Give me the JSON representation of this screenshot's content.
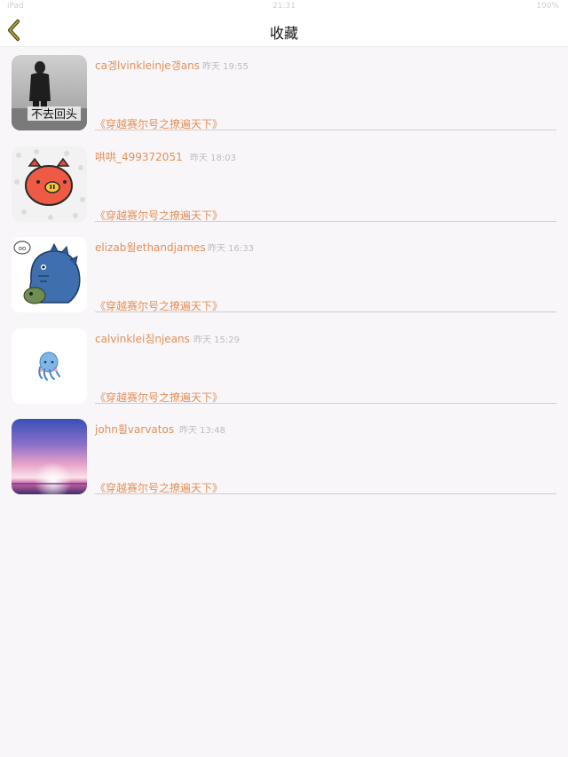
{
  "status_bar": {
    "left": "iPad",
    "center": "21:31",
    "right": "100%"
  },
  "nav": {
    "title": "收藏",
    "back_icon": "chevron-left-icon",
    "accent": "#9a8d1c"
  },
  "items": [
    {
      "author": "ca겡lvinkleinje갱ans",
      "time": "昨天 19:55",
      "book": "《穿越赛尔号之撩遍天下》",
      "avatar": "person-photo"
    },
    {
      "author": "哄哄_499372051",
      "time": "昨天 18:03",
      "book": "《穿越赛尔号之撩遍天下》",
      "avatar": "pig-sticker"
    },
    {
      "author": "elizab윌ethandjames",
      "time": "昨天 16:33",
      "book": "《穿越赛尔号之撩遍天下》",
      "avatar": "dino-sticker"
    },
    {
      "author": "calvinklei짐njeans",
      "time": "昨天 15:29",
      "book": "《穿越赛尔号之撩遍天下》",
      "avatar": "squid-sticker"
    },
    {
      "author": "john휠varvatos",
      "time": "昨天 13:48",
      "book": "《穿越赛尔号之撩遍天下》",
      "avatar": "sunset-photo"
    }
  ],
  "colors": {
    "author_text": "#e39058",
    "time_text": "#bdbdbd",
    "background": "#f8f6f8"
  }
}
